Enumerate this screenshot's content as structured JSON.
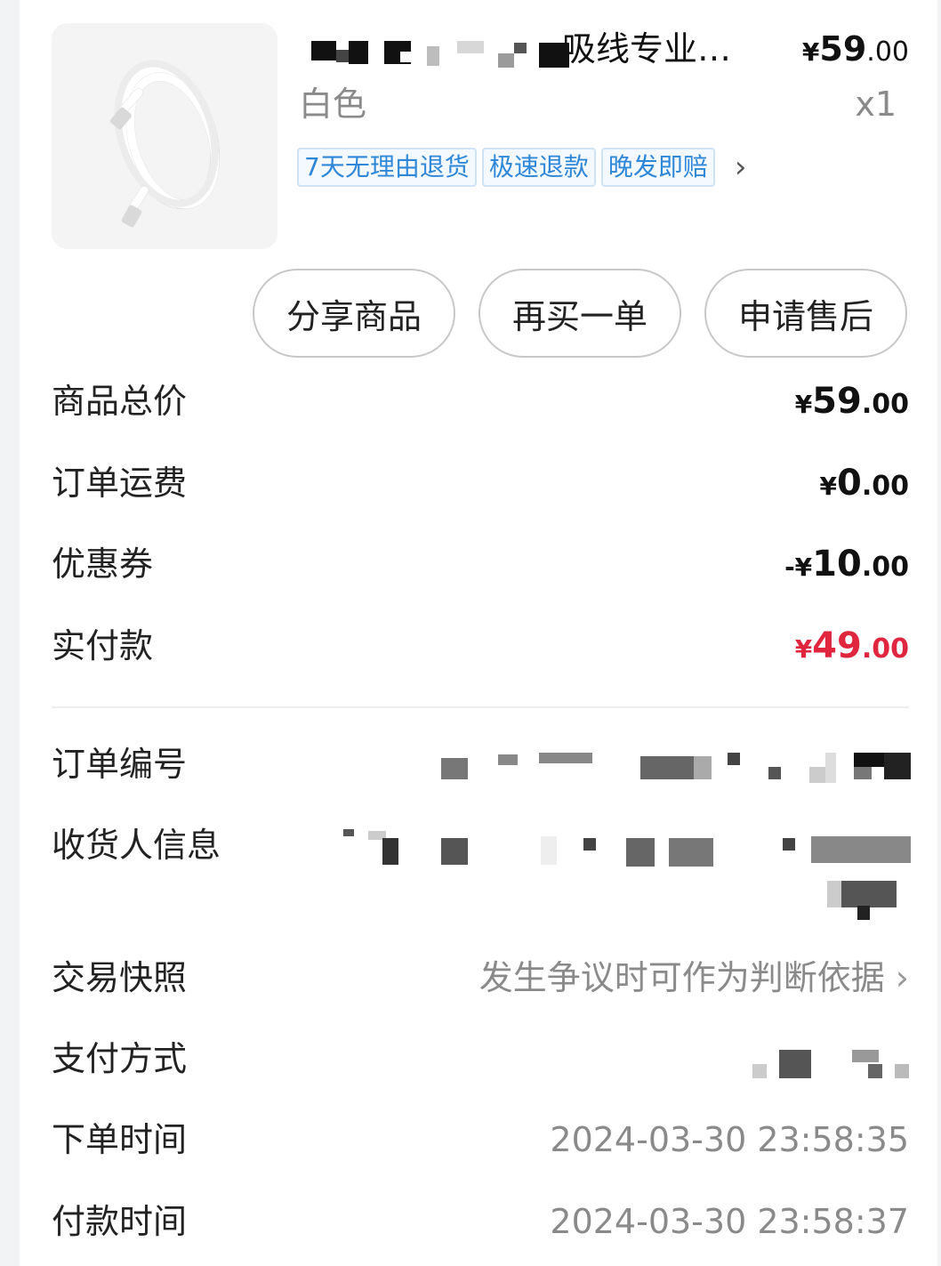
{
  "product": {
    "title_visible": "吸线专业…",
    "price_currency": "¥",
    "price_int": "59",
    "price_dec": ".00",
    "variant": "白色",
    "quantity": "x1",
    "tags": [
      "7天无理由退货",
      "极速退款",
      "晚发即赔"
    ],
    "tags_chevron": "›"
  },
  "actions": {
    "share": "分享商品",
    "rebuy": "再买一单",
    "after_sale": "申请售后"
  },
  "pricing": {
    "subtotal_label": "商品总价",
    "subtotal": {
      "prefix": "¥",
      "int": "59",
      "dec": ".00"
    },
    "shipping_label": "订单运费",
    "shipping": {
      "prefix": "¥",
      "int": "0",
      "dec": ".00"
    },
    "coupon_label": "优惠券",
    "coupon": {
      "prefix": "-¥",
      "int": "10",
      "dec": ".00"
    },
    "paid_label": "实付款",
    "paid": {
      "prefix": "¥",
      "int": "49",
      "dec": ".00"
    }
  },
  "info": {
    "order_no_label": "订单编号",
    "receiver_label": "收货人信息",
    "snapshot_label": "交易快照",
    "snapshot_value": "发生争议时可作为判断依据",
    "snapshot_chevron": "›",
    "payment_label": "支付方式",
    "order_time_label": "下单时间",
    "order_time": "2024-03-30 23:58:35",
    "pay_time_label": "付款时间",
    "pay_time": "2024-03-30 23:58:37"
  },
  "colors": {
    "accent_red": "#e0263f",
    "tag_blue": "#2f87d8",
    "muted_gray": "#8a8a8a"
  }
}
